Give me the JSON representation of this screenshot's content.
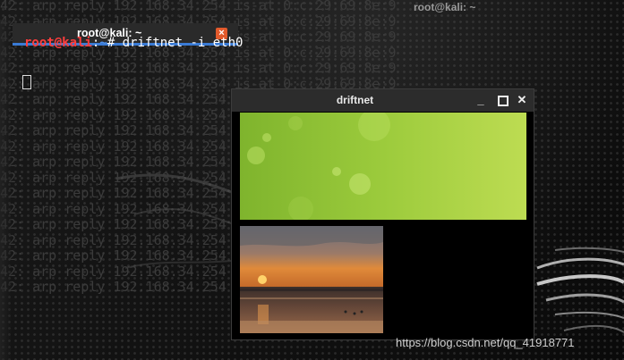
{
  "desktop": {
    "top_window_title": "root@kali: ~",
    "background_lines": [
      "42: arp reply 192.168.34.254 is-at 0:c:29:69:8e:9",
      "42: arp reply 192.168.34.254 is-at 0:c:29:69:8e:9",
      "42: arp reply 192.168.34.254 is-at 0:c:29:69:8e:9",
      "42: arp reply 192.168.34.254 is-at 0:c:29:69:8e:9",
      "42: arp reply 192.168.34.254 is-at 0:c:29:69:8e:9",
      "42: arp reply 192.168.34.254 is-at 0:c:29:69:8e:9",
      "42: arp reply 192.168.34.254 is-at 0:c:29:69:8e:9",
      "42: arp reply 192.168.34.254",
      "42: arp reply 192.168.34.254",
      "42: arp reply 192.168.34.254",
      "42: arp reply 192.168.34.254",
      "42: arp reply 192.168.34.254",
      "42: arp reply 192.168.34.254",
      "42: arp reply 192.168.34.254",
      "42: arp reply 192.168.34.254",
      "42: arp reply 192.168.34.254",
      "42: arp reply 192.168.34.254",
      "42: arp reply 192.168.34.254",
      "42: arp reply 192.168.34.254"
    ]
  },
  "terminal": {
    "tab_title": "root@kali: ~",
    "close_icon": "close-icon",
    "prompt_user": "root@kali",
    "prompt_sep": ":",
    "prompt_path": "~",
    "prompt_symbol": "#",
    "command": " driftnet -i eth0"
  },
  "driftnet": {
    "title": "driftnet",
    "minimize_label": "_",
    "close_label": "✕",
    "images": [
      "green-abstract-image",
      "sunset-beach-image"
    ]
  },
  "watermark": "https://blog.csdn.net/qq_41918771",
  "colors": {
    "accent_blue": "#3a7bd5",
    "close_orange": "#e25a2c",
    "prompt_red": "#ff3d3d",
    "prompt_blue": "#4e8ee6"
  }
}
